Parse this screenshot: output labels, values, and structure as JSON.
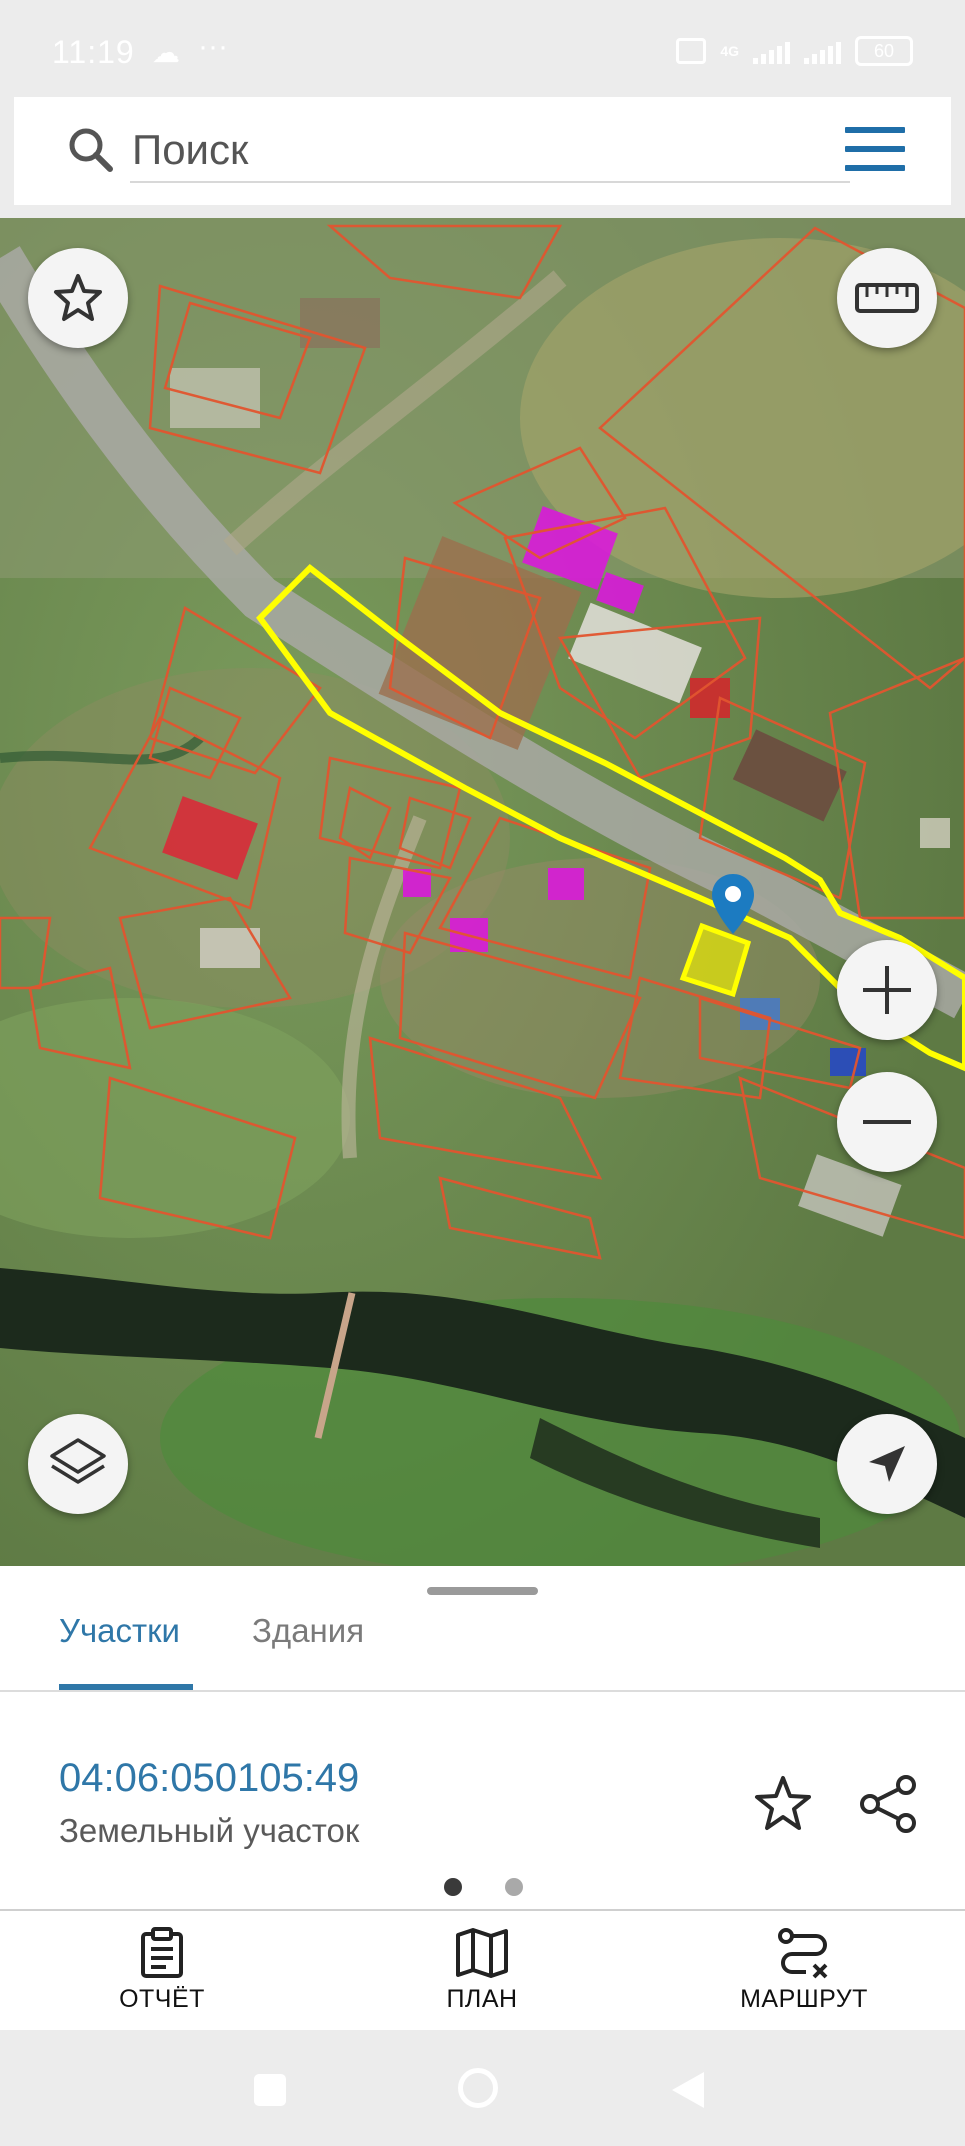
{
  "status_bar": {
    "time": "11:19",
    "network": "4G",
    "battery": "60"
  },
  "search": {
    "placeholder": "Поиск"
  },
  "map": {
    "layers": [
      "cadastral-parcels",
      "buildings",
      "satellite"
    ],
    "colors": {
      "parcel_outline": "#e2552f",
      "selected_road": "#ffff00",
      "selected_parcel_fill": "#f1f000",
      "building_fill": "#d91ad9",
      "marker": "#1c7bc1"
    }
  },
  "sheet": {
    "tabs": [
      {
        "label": "Участки",
        "active": true
      },
      {
        "label": "Здания",
        "active": false
      }
    ],
    "parcel": {
      "cadastral_number": "04:06:050105:49",
      "type": "Земельный участок"
    },
    "pager": {
      "pages": 2,
      "current": 1
    }
  },
  "bottom_nav": {
    "items": [
      {
        "label": "ОТЧЁТ",
        "icon": "report-icon"
      },
      {
        "label": "ПЛАН",
        "icon": "map-plan-icon"
      },
      {
        "label": "МАРШРУТ",
        "icon": "route-icon"
      }
    ]
  }
}
